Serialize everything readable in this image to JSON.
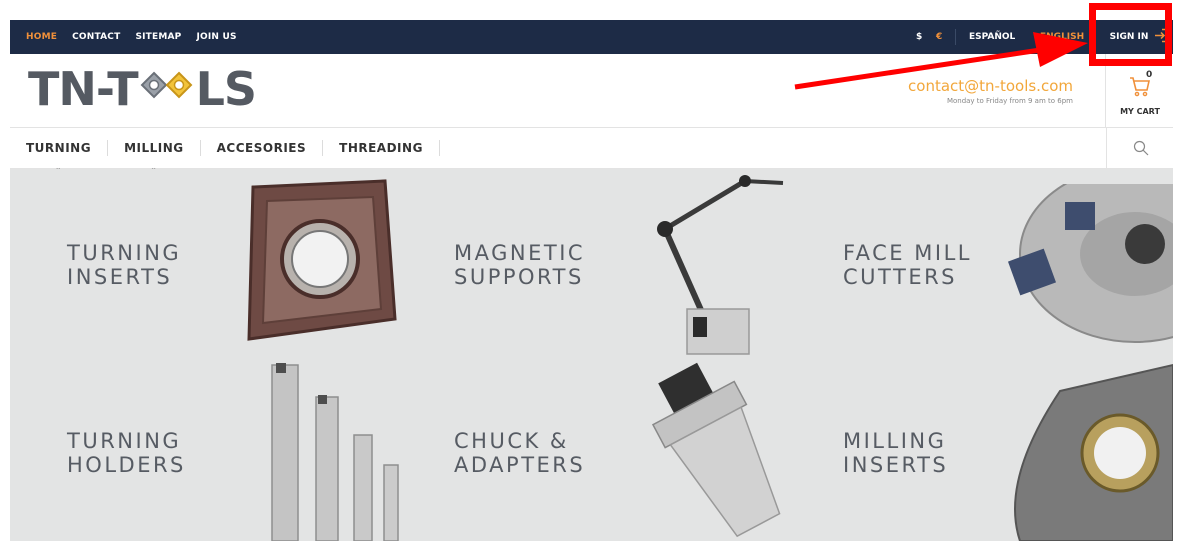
{
  "topbar": {
    "nav": [
      {
        "label": "HOME",
        "active": true
      },
      {
        "label": "CONTACT",
        "active": false
      },
      {
        "label": "SITEMAP",
        "active": false
      },
      {
        "label": "JOIN US",
        "active": false
      }
    ],
    "currency_usd": "$",
    "currency_eur": "€",
    "lang_es": "ESPAÑOL",
    "lang_en": "ENGLISH",
    "sign_in": "SIGN IN"
  },
  "header": {
    "logo_left": "TN-T",
    "logo_right": "LS",
    "email": "contact@tn-tools.com",
    "hours": "Monday to Friday from 9 am to 6pm",
    "cart_label": "MY CART",
    "cart_count": "0"
  },
  "categories": [
    "TURNING",
    "MILLING",
    "ACCESORIES",
    "THREADING"
  ],
  "tiles": [
    {
      "line1": "TURNING",
      "line2": "INSERTS"
    },
    {
      "line1": "MAGNETIC",
      "line2": "SUPPORTS"
    },
    {
      "line1": "FACE MILL",
      "line2": "CUTTERS"
    },
    {
      "line1": "TURNING",
      "line2": "HOLDERS"
    },
    {
      "line1": "CHUCK &",
      "line2": "ADAPTERS"
    },
    {
      "line1": "MILLING",
      "line2": "INSERTS"
    }
  ],
  "colors": {
    "topbar_bg": "#1d2b46",
    "accent_orange": "#f0903a",
    "email_orange": "#f2a73b",
    "annotation_red": "#ff0000",
    "hero_bg": "#e3e4e4"
  }
}
